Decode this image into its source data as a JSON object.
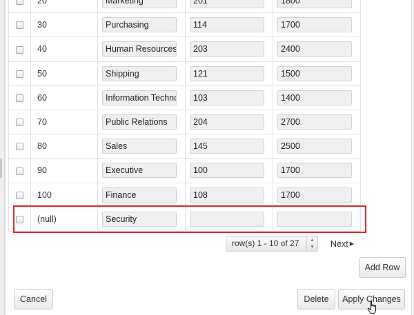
{
  "rows": [
    {
      "id": "20",
      "name": "Marketing",
      "manager": "201",
      "location": "1800"
    },
    {
      "id": "30",
      "name": "Purchasing",
      "manager": "114",
      "location": "1700"
    },
    {
      "id": "40",
      "name": "Human Resources",
      "manager": "203",
      "location": "2400"
    },
    {
      "id": "50",
      "name": "Shipping",
      "manager": "121",
      "location": "1500"
    },
    {
      "id": "60",
      "name": "Information Technol",
      "manager": "103",
      "location": "1400"
    },
    {
      "id": "70",
      "name": "Public Relations",
      "manager": "204",
      "location": "2700"
    },
    {
      "id": "80",
      "name": "Sales",
      "manager": "145",
      "location": "2500"
    },
    {
      "id": "90",
      "name": "Executive",
      "manager": "100",
      "location": "1700"
    },
    {
      "id": "100",
      "name": "Finance",
      "manager": "108",
      "location": "1700"
    },
    {
      "id": "(null)",
      "name": "Security",
      "manager": "",
      "location": ""
    }
  ],
  "pagination": {
    "range_label": "row(s) 1 - 10 of 27",
    "next_label": "Next"
  },
  "buttons": {
    "add_row": "Add Row",
    "cancel": "Cancel",
    "delete": "Delete",
    "apply_changes": "Apply Changes"
  },
  "colors": {
    "highlight": "#e0262b"
  }
}
